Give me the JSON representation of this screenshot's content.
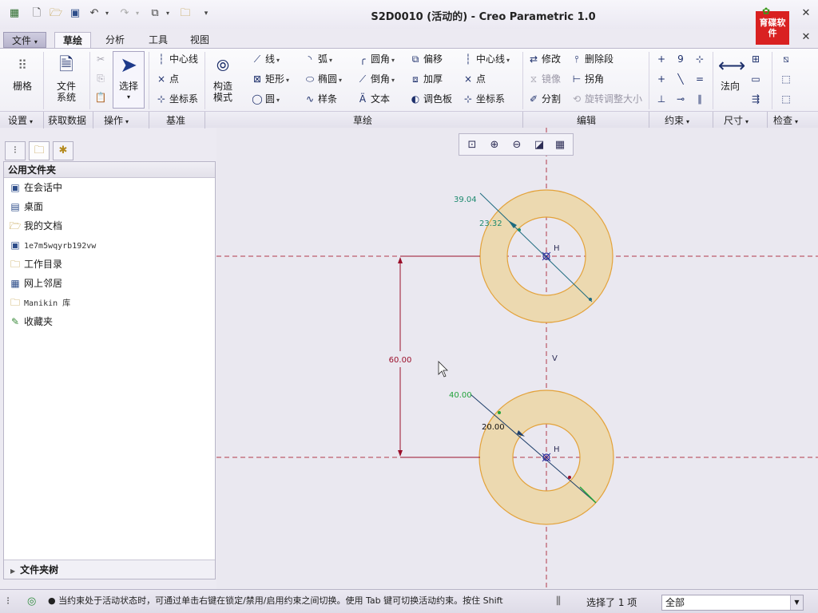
{
  "window": {
    "title": "S2D0010 (活动的) - Creo Parametric 1.0",
    "logo_text": "育碟软件"
  },
  "menu_tabs": [
    "文件",
    "草绘",
    "分析",
    "工具",
    "视图"
  ],
  "ribbon": {
    "settings": {
      "grid_label": "栅格"
    },
    "get_data": {
      "file_system_label": "文件系统"
    },
    "operations": {
      "select_label": "选择"
    },
    "datum": {
      "centerline": "中心线",
      "point": "点",
      "coordinate_system": "坐标系"
    },
    "sketch": {
      "construction_mode": "构造模式",
      "line": "线",
      "rectangle": "矩形",
      "circle": "圆",
      "arc": "弧",
      "ellipse": "椭圆",
      "spline": "样条",
      "fillet": "圆角",
      "chamfer": "倒角",
      "text": "文本",
      "offset": "偏移",
      "thicken": "加厚",
      "palette": "调色板",
      "centerline": "中心线",
      "point": "点",
      "coordinate_system": "坐标系"
    },
    "editing": {
      "modify": "修改",
      "delete_segment": "删除段",
      "mirror": "镜像",
      "corner": "拐角",
      "divide": "分割",
      "rotate_resize": "旋转调整大小"
    },
    "dimension": {
      "normal_label": "法向"
    },
    "group_labels": [
      "设置",
      "获取数据",
      "操作",
      "基准",
      "草绘",
      "编辑",
      "约束",
      "尺寸",
      "检查"
    ]
  },
  "navigator": {
    "header": "公用文件夹",
    "folders": [
      {
        "label": "在会话中",
        "icon": "session-icon"
      },
      {
        "label": "桌面",
        "icon": "desktop-icon"
      },
      {
        "label": "我的文档",
        "icon": "my-documents-icon"
      },
      {
        "label": "1e7m5wqyrb192vw",
        "icon": "computer-icon"
      },
      {
        "label": "工作目录",
        "icon": "working-directory-icon"
      },
      {
        "label": "网上邻居",
        "icon": "network-icon"
      },
      {
        "label": "Manikin 库",
        "icon": "library-icon"
      },
      {
        "label": "收藏夹",
        "icon": "favorites-icon"
      }
    ],
    "folder_tree_label": "文件夹树"
  },
  "sketch": {
    "dimensions": {
      "vertical_distance": "60.00",
      "top_outer_diameter": "39.04",
      "top_inner_diameter": "23.32",
      "bottom_outer_diameter": "40.00",
      "bottom_inner_diameter": "20.00"
    },
    "constraint_labels": {
      "top_horizontal": "H",
      "bottom_horizontal": "H",
      "vertical": "V"
    },
    "colors": {
      "ring_fill": "#ecd9b0",
      "ring_stroke": "#e3a23a",
      "centerline": "#b23a4a",
      "dimension_strong": "#9a0f2a",
      "dimension_weak": "#1e8a6f",
      "dimension_selected": "#23a33c",
      "background": "#eae8f0"
    }
  },
  "status": {
    "message": "● 当约束处于活动状态时，可通过单击右键在锁定/禁用/启用约束之间切换。使用 Tab 键可切换活动约束。按住 Shift",
    "selection_count_text": "选择了 1 项",
    "filter_value": "全部"
  }
}
